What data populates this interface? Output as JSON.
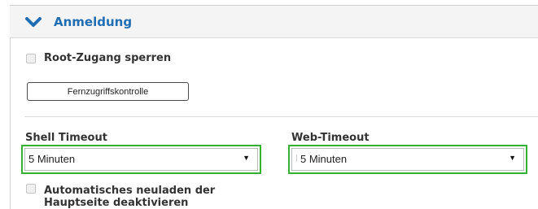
{
  "section": {
    "title": "Anmeldung",
    "expand_icon": "chevron-down-icon",
    "accent_color": "#1f6db3"
  },
  "root_lock": {
    "label": "Root-Zugang sperren",
    "checked": false
  },
  "remote_access_button": {
    "label": "Fernzugriffskontrolle"
  },
  "shell_timeout": {
    "label": "Shell Timeout",
    "value": "5 Minuten"
  },
  "web_timeout": {
    "label": "Web-Timeout",
    "value": "5 Minuten"
  },
  "auto_reload": {
    "label_line1": "Automatisches neuladen der",
    "label_line2": "Hauptseite deaktivieren",
    "checked": false
  },
  "highlight_color": "#35b032"
}
